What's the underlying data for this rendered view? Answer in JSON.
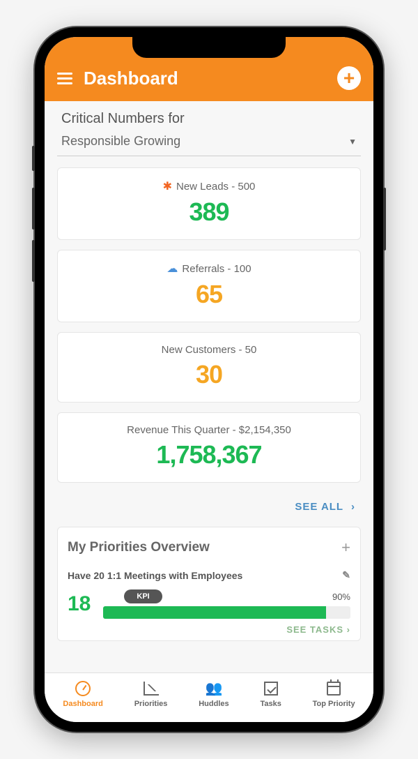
{
  "header": {
    "title": "Dashboard"
  },
  "critical_section": {
    "title": "Critical Numbers for",
    "dropdown_selected": "Responsible Growing",
    "see_all": "SEE ALL"
  },
  "metrics": [
    {
      "label": "New Leads - 500",
      "value": "389",
      "color": "green",
      "icon": "star"
    },
    {
      "label": "Referrals - 100",
      "value": "65",
      "color": "orange",
      "icon": "cloud"
    },
    {
      "label": "New Customers - 50",
      "value": "30",
      "color": "orange",
      "icon": ""
    },
    {
      "label": "Revenue This Quarter - $2,154,350",
      "value": "1,758,367",
      "color": "green",
      "icon": ""
    }
  ],
  "priorities": {
    "title": "My Priorities Overview",
    "item": {
      "label": "Have 20 1:1 Meetings with Employees",
      "value": "18",
      "kpi_label": "KPI",
      "percent": "90%",
      "progress": 90,
      "see_tasks": "SEE TASKS"
    }
  },
  "nav": [
    {
      "label": "Dashboard",
      "active": true
    },
    {
      "label": "Priorities",
      "active": false
    },
    {
      "label": "Huddles",
      "active": false
    },
    {
      "label": "Tasks",
      "active": false
    },
    {
      "label": "Top Priority",
      "active": false
    }
  ]
}
